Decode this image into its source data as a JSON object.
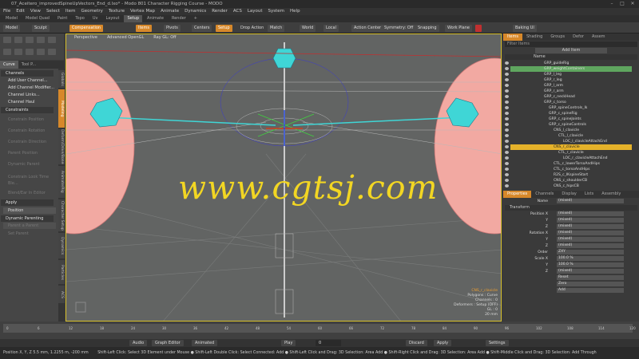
{
  "window": {
    "title": "07_Aceitero_improvedSpineUpVectors_End_d.lxo* - Modo 801 Character Rigging Course - MODO"
  },
  "menu": [
    "File",
    "Edit",
    "View",
    "Select",
    "Item",
    "Geometry",
    "Texture",
    "Vertex Map",
    "Animate",
    "Dynamics",
    "Render",
    "ACS",
    "Layout",
    "System",
    "Help"
  ],
  "layout_tabs": [
    "Model",
    "Model Quad",
    "Paint",
    "Topo",
    "Uv",
    "Layout",
    "Setup",
    "Animate",
    "Render",
    "+"
  ],
  "layout_active": "Setup",
  "toolbar": {
    "model": "Model",
    "sculpt": "Sculpt",
    "compensation": "Compensation",
    "items": "Items",
    "pivots": "Pivots",
    "centers": "Centers",
    "setup": "Setup",
    "drop_action": "Drop Action",
    "match": "Match",
    "world": "World",
    "local": "Local",
    "action_center": "Action Center",
    "symmetry": "Symmetry: Off",
    "snapping": "Snapping",
    "work_plane": "Work Plane",
    "baking_ui": "Baking UI"
  },
  "left_tabs": [
    "Curve",
    "Tool P..."
  ],
  "left_panel": {
    "channels_header": "Channels",
    "add_user_channel": "Add User Channel...",
    "add_channel_modifier": "Add Channel Modifier...",
    "channel_links": "Channel Links...",
    "channel_haul": "Channel Haul",
    "constraints_header": "Constraints",
    "constraint_position": "Constrain Position",
    "constraint_rotation": "Constrain Rotation",
    "constraint_direction": "Constrain Direction",
    "constraint_parent": "Parent Position",
    "constraint_vis": "Dynamic Parent",
    "constraint_look": "Constrain Look Time Ble...",
    "constraint_blend": "Blend/Ear In Editor",
    "apply_header": "Apply",
    "position": "Position",
    "dynamic_parenting_header": "Dynamic Parenting",
    "parent_label": "Parent a Parent",
    "set_parent": "Set Parent"
  },
  "left_vtabs": [
    "Globals",
    "Modeling",
    "Deform/Drive/Bones",
    "Animate/Rig",
    "Character Setup",
    "Dynamics",
    "Particles",
    "ACS"
  ],
  "viewport": {
    "tabs": [
      "Perspective",
      "Advanced OpenGL",
      "Ray GL: Off"
    ],
    "watermark": "www.cgtsj.com",
    "info_name": "CNS_r_clavicle",
    "info_lines": [
      "Polygons : Curve",
      "Channels : 0",
      "Deformers : Setup (OFF)",
      "GL : 0",
      "20 mm"
    ]
  },
  "items_panel": {
    "tabs": [
      "Items",
      "Shading",
      "Groups",
      "Defor",
      "Assem"
    ],
    "filter": "Filter Items",
    "add_item": "Add Item",
    "name_col": "Name",
    "rows": [
      {
        "label": "GRP_guideRig",
        "indent": 0,
        "state": "normal"
      },
      {
        "label": "GRP_weightContainers",
        "indent": 0,
        "state": "hi"
      },
      {
        "label": "GRP_l_leg",
        "indent": 0,
        "state": "normal"
      },
      {
        "label": "GRP_r_leg",
        "indent": 0,
        "state": "normal"
      },
      {
        "label": "GRP_l_arm",
        "indent": 0,
        "state": "normal"
      },
      {
        "label": "GRP_r_arm",
        "indent": 0,
        "state": "normal"
      },
      {
        "label": "GRP_c_neckHead",
        "indent": 0,
        "state": "normal"
      },
      {
        "label": "GRP_c_torso",
        "indent": 0,
        "state": "normal"
      },
      {
        "label": "GRP_spineControls_lk",
        "indent": 1,
        "state": "normal"
      },
      {
        "label": "GRP_c_spineRig",
        "indent": 1,
        "state": "normal"
      },
      {
        "label": "GRP_c_spineJoints",
        "indent": 1,
        "state": "normal"
      },
      {
        "label": "GRP_c_spineControls",
        "indent": 1,
        "state": "normal"
      },
      {
        "label": "CNS_l_clavicle",
        "indent": 2,
        "state": "normal"
      },
      {
        "label": "CTL_l_clavicle",
        "indent": 3,
        "state": "normal"
      },
      {
        "label": "LOC_l_clavicleAttachEnd",
        "indent": 4,
        "state": "normal"
      },
      {
        "label": "CNS_r_clavicle",
        "indent": 2,
        "state": "sel"
      },
      {
        "label": "CTL_r_clavicle",
        "indent": 3,
        "state": "normal"
      },
      {
        "label": "LOC_r_clavicleAttachEnd",
        "indent": 4,
        "state": "normal"
      },
      {
        "label": "CTL_c_lowerTorsoAndHips",
        "indent": 2,
        "state": "normal"
      },
      {
        "label": "CTL_c_torsoAndHips",
        "indent": 2,
        "state": "normal"
      },
      {
        "label": "R2S_c_IKspineStart",
        "indent": 2,
        "state": "normal"
      },
      {
        "label": "CNS_c_shoulderCB",
        "indent": 2,
        "state": "normal"
      },
      {
        "label": "CNS_c_hipsCB",
        "indent": 2,
        "state": "normal"
      }
    ]
  },
  "properties_panel": {
    "tabs": [
      "Properties",
      "Channels",
      "Display",
      "Lists",
      "Assembly"
    ],
    "name_label": "Name",
    "name_value": "(mixed)",
    "transform_header": "Transform",
    "rows": [
      {
        "label": "Position X",
        "value": "(mixed)"
      },
      {
        "label": "Y",
        "value": "(mixed)"
      },
      {
        "label": "Z",
        "value": "(mixed)"
      },
      {
        "label": "Rotation X",
        "value": "(mixed)"
      },
      {
        "label": "Y",
        "value": "(mixed)"
      },
      {
        "label": "Z",
        "value": "(mixed)"
      },
      {
        "label": "Order",
        "value": "ZXY"
      },
      {
        "label": "Scale X",
        "value": "100.0 %"
      },
      {
        "label": "Y",
        "value": "100.0 %"
      },
      {
        "label": "Z",
        "value": "(mixed)"
      },
      {
        "label": "",
        "value": "Reset"
      },
      {
        "label": "",
        "value": "Zero"
      },
      {
        "label": "",
        "value": "Add"
      }
    ]
  },
  "timeline": {
    "ticks": [
      "0",
      "6",
      "12",
      "18",
      "24",
      "30",
      "36",
      "42",
      "48",
      "54",
      "60",
      "66",
      "72",
      "78",
      "84",
      "90",
      "96",
      "102",
      "108",
      "114",
      "120"
    ],
    "end": "120"
  },
  "playbar": {
    "audio": "Audio",
    "graph_editor": "Graph Editor",
    "animated": "Animated",
    "play": "Play",
    "frame": "0",
    "discard": "Discard",
    "apply": "Apply",
    "settings": "Settings"
  },
  "status": {
    "coords": "Position X, Y, Z  5.5 mm, 1.2255 m, -200 mm",
    "hints": "Shift-Left Click: Select 3D Element under Mouse ● Shift-Left Double Click: Select Connected: Add ● Shift-Left Click and Drag: 3D Selection: Area Add ● Shift-Right Click and Drag: 3D Selection: Area Add ● Shift-Middle Click and Drag: 3D Selection: Add Through"
  },
  "colors": {
    "accent": "#d7882a",
    "viewport": "#626463",
    "watermark": "#f2d623",
    "selected_row": "#e5b22a",
    "highlight_row": "#5fa65f",
    "shield": "#f2a9a2",
    "mesh": "#3fd6d6"
  }
}
